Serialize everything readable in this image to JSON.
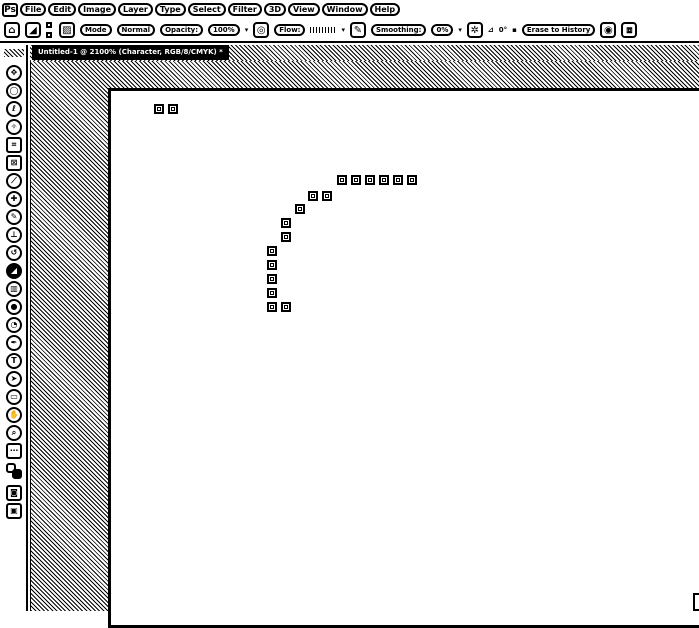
{
  "app": {
    "logo": "Ps"
  },
  "menu": [
    "File",
    "Edit",
    "Image",
    "Layer",
    "Type",
    "Select",
    "Filter",
    "3D",
    "View",
    "Window",
    "Help"
  ],
  "options_bar": {
    "mode_label": "Mode",
    "mode_value": "Normal",
    "opacity_label": "Opacity:",
    "opacity_value": "100%",
    "flow_label": "Flow:",
    "smoothing_label": "Smoothing:",
    "smoothing_value": "0%",
    "angle_value": "0°",
    "erase_to_history_label": "Erase to History"
  },
  "document_tab": {
    "title": "Untitled-1 @ 2100% (Character, RGB/8/CMYK) *"
  },
  "toolbar": {
    "tools": [
      "move",
      "marquee",
      "lasso",
      "quick-select",
      "crop",
      "frame",
      "eyedropper",
      "healing",
      "brush",
      "clone-stamp",
      "history-brush",
      "eraser",
      "gradient",
      "blur",
      "dodge",
      "pen",
      "type",
      "path-select",
      "rectangle",
      "hand",
      "zoom",
      "more",
      "colors",
      "quick-mask",
      "screen-mode"
    ],
    "active_tool": "eraser"
  },
  "canvas": {
    "background": "#ffffff",
    "pixel_color": "#000000"
  }
}
